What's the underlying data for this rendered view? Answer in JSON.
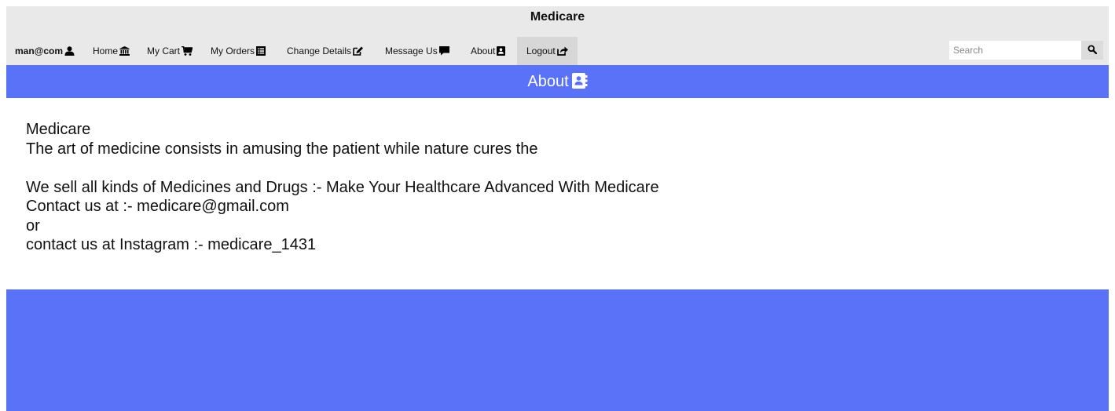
{
  "header": {
    "title": "Medicare"
  },
  "nav": {
    "user": "man@com",
    "home": "Home",
    "cart": "My Cart",
    "orders": "My Orders",
    "change_details": "Change Details",
    "message": "Message Us",
    "about": "About",
    "logout": "Logout"
  },
  "search": {
    "placeholder": "Search",
    "value": ""
  },
  "banner": {
    "title": "About"
  },
  "content": {
    "brand": "Medicare",
    "quote": "The art of medicine consists in amusing the patient while nature cures the",
    "tagline": "We sell all kinds of Medicines and Drugs :- Make Your Healthcare Advanced With Medicare",
    "contact_email": "Contact us at :- medicare@gmail.com",
    "or": "or",
    "contact_instagram": "contact us at Instagram :- medicare_1431"
  },
  "colors": {
    "accent": "#5a72f8",
    "topbar": "#e9e9e9"
  },
  "icons": {
    "user": "user-icon",
    "home": "bank-icon",
    "cart": "cart-icon",
    "orders": "list-icon",
    "change_details": "edit-icon",
    "message": "comment-icon",
    "about": "address-book-icon",
    "logout": "share-icon",
    "search": "search-icon"
  }
}
